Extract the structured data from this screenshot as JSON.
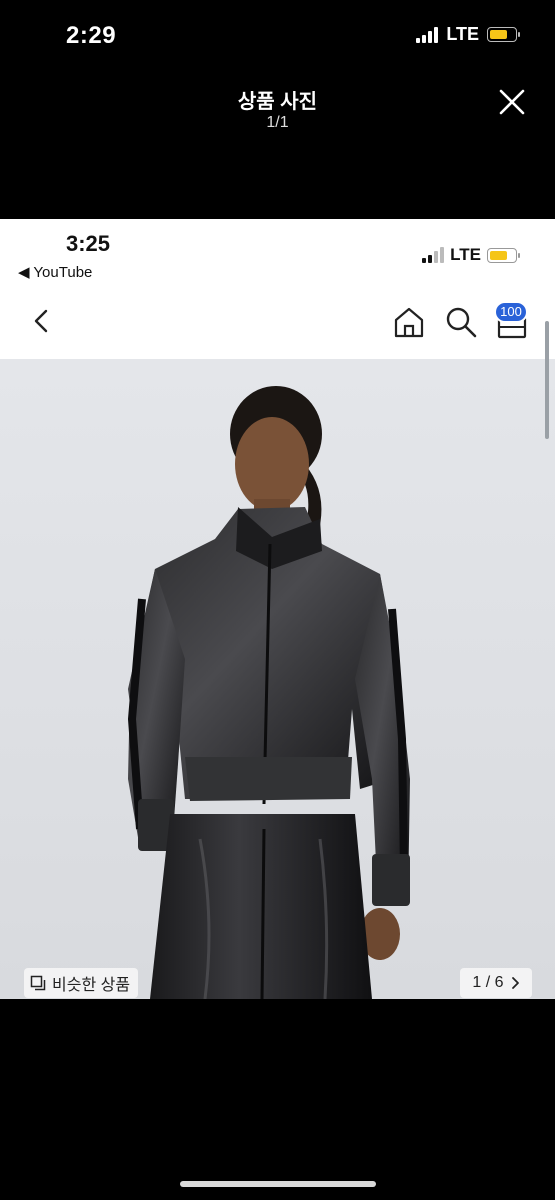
{
  "outer_status": {
    "time": "2:29",
    "network": "LTE"
  },
  "viewer": {
    "title": "상품 사진",
    "counter": "1/1",
    "close_icon": "close-icon"
  },
  "inner_status": {
    "time": "3:25",
    "back_app": "◀ YouTube",
    "network": "LTE"
  },
  "nav": {
    "back_icon": "chevron-left-icon",
    "home_icon": "home-icon",
    "search_icon": "search-icon",
    "cart_icon": "cart-icon",
    "cart_badge": "100"
  },
  "photo": {
    "description_icon": "product-photo-woman-black-track-jacket"
  },
  "overlay": {
    "similar_label": "비슷한 상품",
    "similar_icon": "copy-icon",
    "pager": "1 / 6",
    "pager_icon": "chevron-right-icon"
  },
  "colors": {
    "badge": "#2a62d8",
    "battery": "#f5c518",
    "photo_bg": "#dfe1e5"
  }
}
